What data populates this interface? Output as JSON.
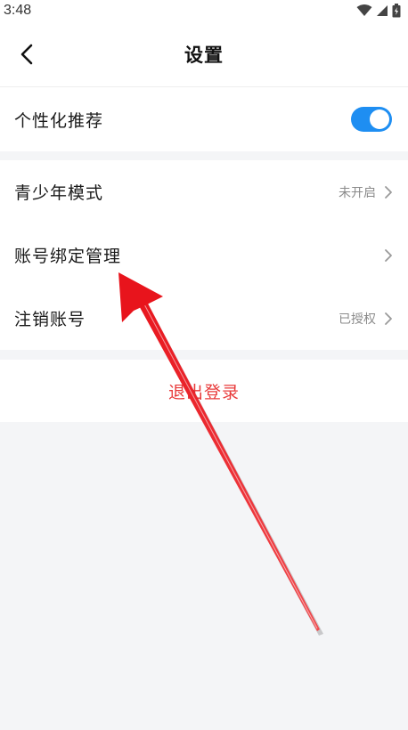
{
  "status_bar": {
    "time": "3:48"
  },
  "nav": {
    "title": "设置"
  },
  "personalized": {
    "label": "个性化推荐",
    "toggle_on": true
  },
  "settings_list": {
    "youth_mode": {
      "label": "青少年模式",
      "status": "未开启"
    },
    "account_binding": {
      "label": "账号绑定管理"
    },
    "deregister": {
      "label": "注销账号",
      "status": "已授权"
    }
  },
  "logout": {
    "label": "退出登录"
  },
  "colors": {
    "accent": "#1e8ef2",
    "danger": "#e83a3a",
    "annotation_arrow": "#e8141c"
  },
  "icons": {
    "back": "chevron-left-icon",
    "row_arrow": "chevron-right-icon"
  }
}
